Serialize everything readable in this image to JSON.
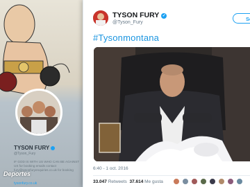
{
  "background_profile": {
    "name": "TYSON FURY",
    "handle": "@Tyson_Fury",
    "bio": "IF GOD IS WITH US WHO CAN BE AGAINST US for booking emails contact fury@tysonfuryenquiries.co.uk for booking",
    "link": "tysonfury.co.uk"
  },
  "tweet": {
    "author_name": "TYSON FURY",
    "author_handle": "@Tyson_Fury",
    "follow_label": "Seg",
    "hashtag": "#Tysonmontana",
    "timestamp": "6:40 - 1 oct. 2016",
    "retweets_count": "33.047",
    "retweets_label": "Retweets",
    "likes_count": "37.614",
    "likes_label": "Me gusta"
  },
  "watermark": "Deportes",
  "colors": {
    "accent": "#1da1f2",
    "hashtag": "#1b95e0"
  },
  "icons": {
    "verified": "verified-badge-icon"
  }
}
